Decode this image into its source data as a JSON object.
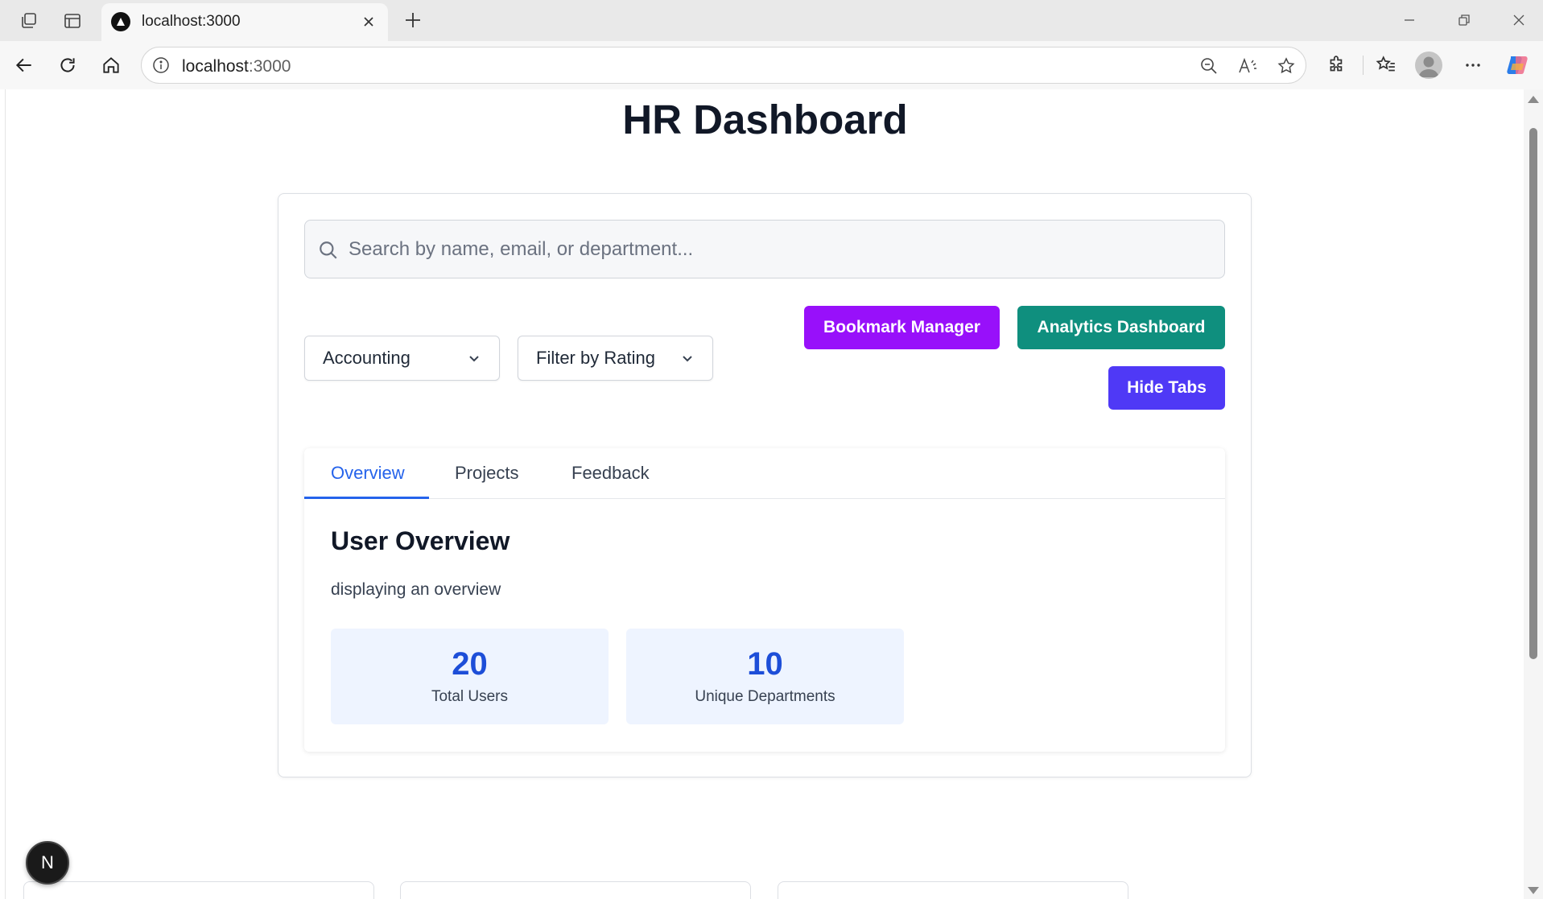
{
  "browser": {
    "tab_title": "localhost:3000",
    "address_host": "localhost",
    "address_port": ":3000",
    "icons": [
      "workspaces-icon",
      "tab-actions-icon",
      "close-icon",
      "new-tab-icon",
      "minimize-icon",
      "restore-icon",
      "window-close-icon",
      "back-icon",
      "refresh-icon",
      "home-icon",
      "site-info-icon",
      "zoom-out-icon",
      "read-aloud-icon",
      "favorite-star-icon",
      "extensions-icon",
      "favorites-icon",
      "profile-avatar",
      "more-icon",
      "copilot-icon"
    ]
  },
  "page": {
    "title": "HR Dashboard"
  },
  "search": {
    "placeholder": "Search by name, email, or department..."
  },
  "filters": {
    "department_selected": "Accounting",
    "rating_placeholder": "Filter by Rating"
  },
  "actions": {
    "bookmark_label": "Bookmark Manager",
    "analytics_label": "Analytics Dashboard",
    "hide_tabs_label": "Hide Tabs"
  },
  "colors": {
    "bookmark": "#9810fa",
    "analytics": "#0f8f7e",
    "hide_tabs": "#4f39f6",
    "accent": "#2563eb"
  },
  "tabs": [
    {
      "label": "Overview",
      "active": true
    },
    {
      "label": "Projects",
      "active": false
    },
    {
      "label": "Feedback",
      "active": false
    }
  ],
  "overview": {
    "title": "User Overview",
    "description": "displaying an overview",
    "stats": [
      {
        "value": "20",
        "label": "Total Users"
      },
      {
        "value": "10",
        "label": "Unique Departments"
      }
    ]
  },
  "dev_badge": "N"
}
